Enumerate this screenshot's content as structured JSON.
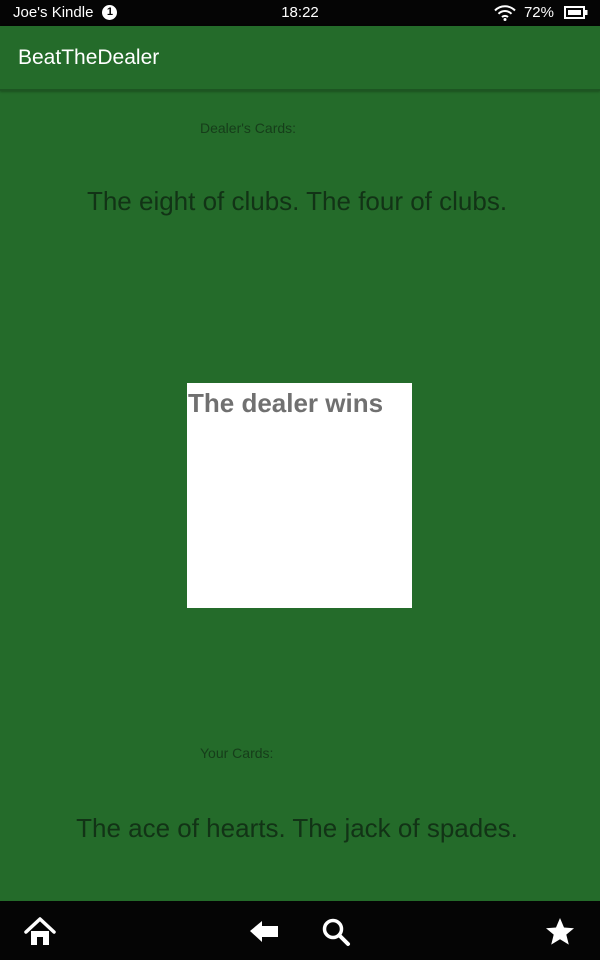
{
  "status_bar": {
    "device_name": "Joe's Kindle",
    "notification_count": "1",
    "time": "18:22",
    "battery_percent": "72%",
    "icons": [
      "wifi-icon",
      "battery-icon"
    ]
  },
  "app_bar": {
    "title": "BeatTheDealer"
  },
  "dealer": {
    "label": "Dealer's Cards:",
    "cards": "The eight of clubs. The four of clubs."
  },
  "result": {
    "text": "The dealer wins"
  },
  "player": {
    "label": "Your Cards:",
    "cards": "The ace of hearts. The jack of spades."
  },
  "nav_bar": {
    "icons": [
      "home-icon",
      "back-icon",
      "search-icon",
      "favorites-icon"
    ]
  },
  "colors": {
    "background": "#246b2a",
    "status_bar": "#050505",
    "result_box": "#ffffff",
    "result_text": "#707070",
    "cards_text": "#123316"
  }
}
